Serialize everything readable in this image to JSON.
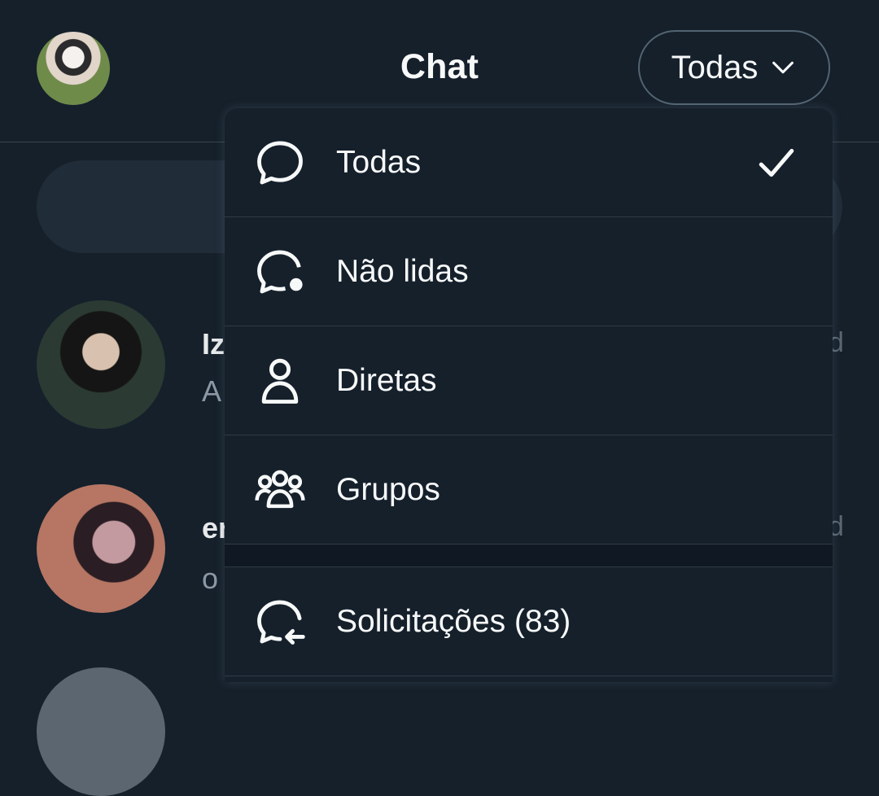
{
  "header": {
    "title": "Chat",
    "filter_value": "Todas"
  },
  "conversations": [
    {
      "name_fragment": "Iz",
      "preview_fragment": "A",
      "time_fragment": "d"
    },
    {
      "name_fragment": "er",
      "preview_fragment": "o",
      "time_fragment": "d"
    }
  ],
  "menu": {
    "items": [
      {
        "label": "Todas",
        "icon": "chat-bubble-icon",
        "selected": true
      },
      {
        "label": "Não lidas",
        "icon": "chat-bubble-unread-icon"
      },
      {
        "label": "Diretas",
        "icon": "person-icon"
      },
      {
        "label": "Grupos",
        "icon": "group-icon"
      }
    ],
    "requests": {
      "label": "Solicitações (83)",
      "icon": "chat-bubble-request-icon"
    }
  },
  "colors": {
    "background": "#15202b",
    "text": "#f7f9f9",
    "muted": "#8b98a5",
    "border": "#38444d"
  }
}
